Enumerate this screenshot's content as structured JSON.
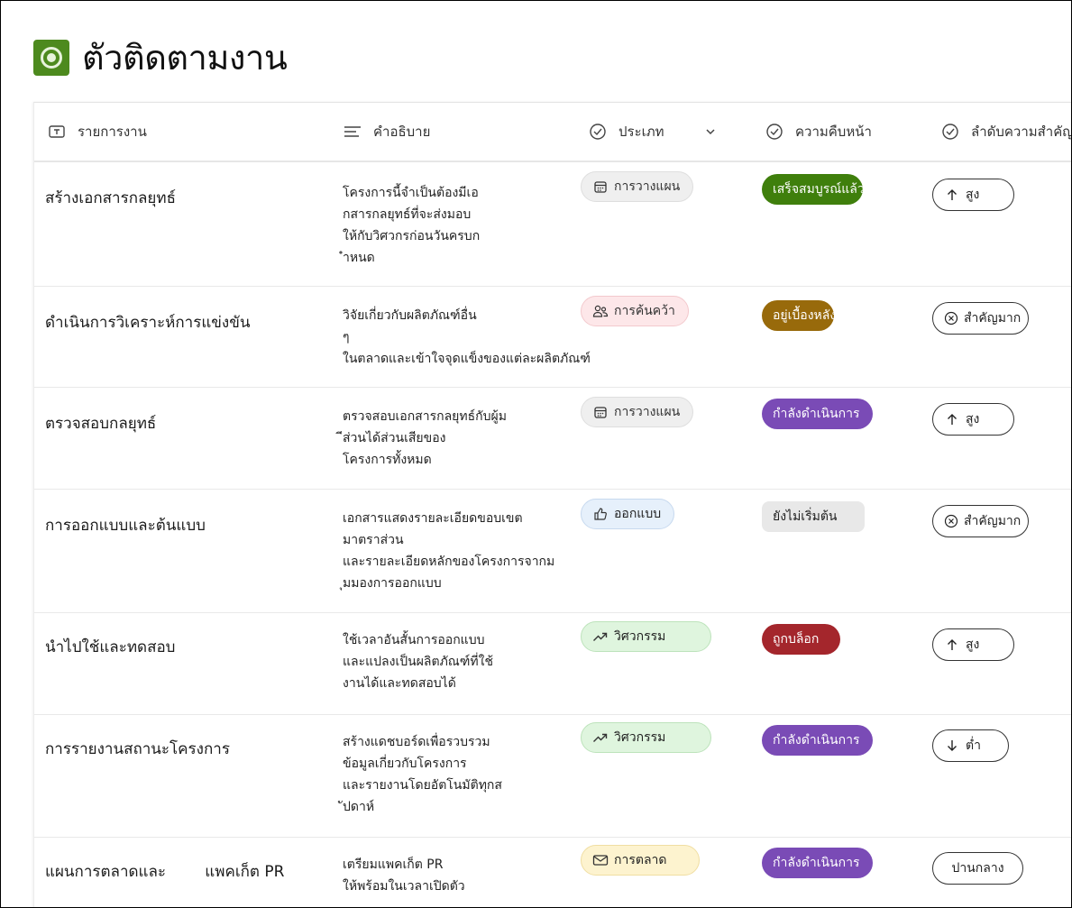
{
  "app": {
    "title": "ตัวติดตามงาน"
  },
  "columns": {
    "task": "รายการงาน",
    "description": "คำอธิบาย",
    "category": "ประเภท",
    "progress": "ความคืบหน้า",
    "priority": "ลำดับความสำคัญ"
  },
  "rows": [
    {
      "task": "สร้างเอกสารกลยุทธ์",
      "description": [
        "โครงการนี้จำเป็นต้องมีเอ",
        "กสารกลยุทธ์ที่จะส่งมอบ",
        "ให้กับวิศวกรก่อนวันครบก",
        "ำหนด"
      ],
      "category": "การวางแผน",
      "progress": "เสร็จสมบูรณ์แล้ว",
      "priority": "สูง"
    },
    {
      "task": "ดำเนินการวิเคราะห์การแข่งขัน",
      "description": [
        "วิจัยเกี่ยวกับผลิตภัณฑ์อื่น",
        "ๆ",
        "ในตลาดและเข้าใจจุดแข็งของแต่ละผลิตภัณฑ์"
      ],
      "category": "การค้นคว้า",
      "progress": "อยู่เบื้องหลัง",
      "priority": "สำคัญมาก"
    },
    {
      "task": "ตรวจสอบกลยุทธ์",
      "description": [
        "ตรวจสอบเอกสารกลยุทธ์กับผู้ม",
        "ีส่วนได้ส่วนเสียของ",
        "โครงการทั้งหมด"
      ],
      "category": "การวางแผน",
      "progress": "กำลังดำเนินการ",
      "priority": "สูง"
    },
    {
      "task": "การออกแบบและต้นแบบ",
      "description": [
        "เอกสารแสดงรายละเอียดขอบเขต",
        "มาตราส่วน",
        "และรายละเอียดหลักของโครงการจากม",
        "ุมมองการออกแบบ"
      ],
      "category": "ออกแบบ",
      "progress": "ยังไม่เริ่มต้น",
      "priority": "สำคัญมาก"
    },
    {
      "task": "นำไปใช้และทดสอบ",
      "description": [
        "ใช้เวลาอันสั้นการออกแบบ",
        "และแปลงเป็นผลิตภัณฑ์ที่ใช้",
        "งานได้และทดสอบได้"
      ],
      "category": "วิศวกรรม",
      "progress": "ถูกบล็อก",
      "priority": "สูง"
    },
    {
      "task": "การรายงานสถานะโครงการ",
      "description": [
        "สร้างแดชบอร์ดเพื่อรวบรวม",
        "ข้อมูลเกี่ยวกับโครงการ",
        "และรายงานโดยอัตโนมัติทุกส",
        "ัปดาห์"
      ],
      "category": "วิศวกรรม",
      "progress": "กำลังดำเนินการ",
      "priority": "ต่ำ"
    },
    {
      "task": "แผนการตลาดและ        แพคเก็ต PR",
      "description": [
        "เตรียมแพคเก็ต PR",
        "ให้พร้อมในเวลาเปิดตัว"
      ],
      "category": "การตลาด",
      "progress": "กำลังดำเนินการ",
      "priority": "ปานกลาง"
    }
  ],
  "colors": {
    "done": "#3f7f0c",
    "behind": "#986a0b",
    "in_progress": "#7a4bb6",
    "not_started": "#e8e8e8",
    "blocked": "#a4262c",
    "logo": "#4d8a1e"
  },
  "icons": {
    "planning": "calendar-icon",
    "research": "people-icon",
    "design": "thumbs-up-icon",
    "engineering": "trending-icon",
    "marketing": "mail-icon",
    "high": "arrow-up-icon",
    "critical": "circle-x-icon",
    "low": "arrow-down-icon"
  }
}
